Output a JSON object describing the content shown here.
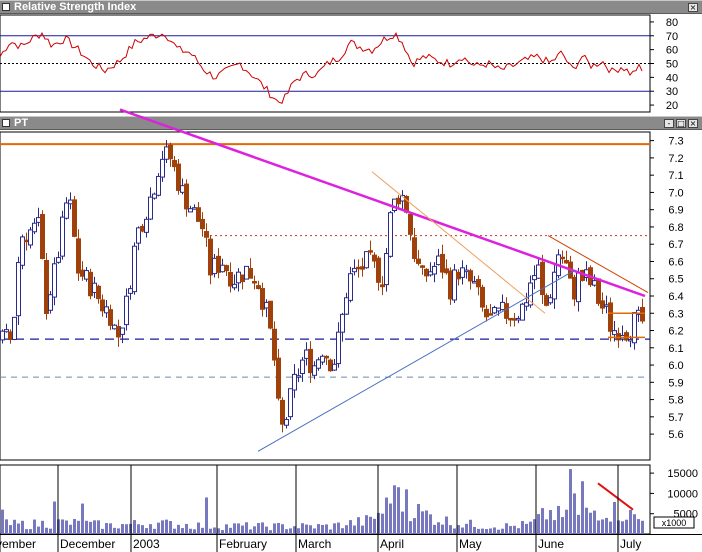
{
  "rsi_panel": {
    "title": "Relative Strength Index",
    "y_ticks": [
      80,
      70,
      60,
      50,
      40,
      30,
      20
    ],
    "levels": {
      "upper": 70,
      "mid": 50,
      "lower": 30
    },
    "ylim": [
      15,
      85
    ],
    "line_color": "#cc0000"
  },
  "price_panel": {
    "title": "PT",
    "y_ticks": [
      7.3,
      7.2,
      7.1,
      7.0,
      6.9,
      6.8,
      6.7,
      6.6,
      6.5,
      6.4,
      6.3,
      6.2,
      6.1,
      6.0,
      5.9,
      5.8,
      5.7,
      5.6
    ],
    "ylim": [
      5.45,
      7.35
    ]
  },
  "volume_panel": {
    "y_ticks": [
      "15000",
      "10000",
      "5000"
    ],
    "unit_label": "x1000",
    "ylim": [
      0,
      17000
    ],
    "bar_color": "#7878c0"
  },
  "window_buttons": {
    "minimize": "-",
    "maximize": "□",
    "close": "×"
  },
  "colors": {
    "up_candle_fill": "#ffffff",
    "up_candle_border": "#2a2a8a",
    "down_candle": "#a0400a",
    "resistance_line": "#e0e000",
    "orange_line": "#e26a00",
    "magenta_trend": "#dd22dd",
    "blue_dash": "#1a1a9a",
    "red_dotted": "#cc3333"
  },
  "chart_data": {
    "type": "candlestick",
    "x_axis_labels": [
      "vember",
      "December",
      "2003",
      "February",
      "March",
      "April",
      "May",
      "June",
      "July"
    ],
    "price": {
      "anchors": [
        [
          0,
          6.15
        ],
        [
          12,
          6.15
        ],
        [
          20,
          6.75
        ],
        [
          38,
          6.8
        ],
        [
          46,
          6.35
        ],
        [
          55,
          6.55
        ],
        [
          68,
          7.0
        ],
        [
          78,
          6.55
        ],
        [
          92,
          6.45
        ],
        [
          102,
          6.35
        ],
        [
          110,
          6.3
        ],
        [
          117,
          6.15
        ],
        [
          126,
          6.35
        ],
        [
          136,
          6.75
        ],
        [
          152,
          7.0
        ],
        [
          161,
          7.22
        ],
        [
          170,
          7.2
        ],
        [
          182,
          7.0
        ],
        [
          192,
          6.9
        ],
        [
          202,
          6.8
        ],
        [
          210,
          6.55
        ],
        [
          222,
          6.6
        ],
        [
          233,
          6.5
        ],
        [
          246,
          6.55
        ],
        [
          257,
          6.5
        ],
        [
          266,
          6.3
        ],
        [
          273,
          6.1
        ],
        [
          280,
          5.6
        ],
        [
          286,
          5.7
        ],
        [
          294,
          5.9
        ],
        [
          304,
          6.05
        ],
        [
          314,
          6.0
        ],
        [
          322,
          6.1
        ],
        [
          333,
          6.0
        ],
        [
          340,
          6.2
        ],
        [
          348,
          6.5
        ],
        [
          358,
          6.55
        ],
        [
          368,
          6.6
        ],
        [
          376,
          6.55
        ],
        [
          383,
          6.5
        ],
        [
          391,
          6.9
        ],
        [
          399,
          7.0
        ],
        [
          405,
          6.95
        ],
        [
          412,
          6.7
        ],
        [
          421,
          6.5
        ],
        [
          430,
          6.55
        ],
        [
          440,
          6.6
        ],
        [
          450,
          6.45
        ],
        [
          458,
          6.55
        ],
        [
          466,
          6.5
        ],
        [
          475,
          6.45
        ],
        [
          483,
          6.3
        ],
        [
          491,
          6.25
        ],
        [
          500,
          6.3
        ],
        [
          508,
          6.3
        ],
        [
          517,
          6.3
        ],
        [
          524,
          6.35
        ],
        [
          531,
          6.5
        ],
        [
          538,
          6.55
        ],
        [
          544,
          6.3
        ],
        [
          551,
          6.45
        ],
        [
          558,
          6.65
        ],
        [
          565,
          6.6
        ],
        [
          572,
          6.4
        ],
        [
          578,
          6.5
        ],
        [
          586,
          6.5
        ],
        [
          593,
          6.45
        ],
        [
          600,
          6.35
        ],
        [
          606,
          6.3
        ],
        [
          612,
          6.2
        ],
        [
          620,
          6.22
        ],
        [
          628,
          6.2
        ],
        [
          634,
          6.25
        ],
        [
          640,
          6.25
        ]
      ],
      "key_levels": {
        "orange_resistance": 7.28,
        "red_dotted_resistance": 6.75,
        "blue_dashed_support": 6.15,
        "grey_dashed_support": 5.93
      },
      "trendlines": [
        {
          "name": "magenta down-trend",
          "from": [
            120,
            7.48
          ],
          "to": [
            645,
            6.4
          ]
        },
        {
          "name": "blue up-trend",
          "from": [
            258,
            5.5
          ],
          "to": [
            575,
            6.55
          ]
        },
        {
          "name": "orange down-trend (Apr-May)",
          "from": [
            372,
            7.12
          ],
          "to": [
            545,
            6.3
          ]
        },
        {
          "name": "orange down-trend (Jun-Jul)",
          "from": [
            548,
            6.75
          ],
          "to": [
            648,
            6.42
          ]
        }
      ],
      "triangle_box": {
        "x": [
          608,
          645
        ],
        "top": 6.3,
        "bottom": 6.16
      }
    },
    "rsi": {
      "anchors": [
        [
          0,
          55
        ],
        [
          10,
          66
        ],
        [
          22,
          62
        ],
        [
          32,
          68
        ],
        [
          42,
          72
        ],
        [
          52,
          63
        ],
        [
          65,
          68
        ],
        [
          78,
          60
        ],
        [
          92,
          50
        ],
        [
          105,
          45
        ],
        [
          120,
          52
        ],
        [
          135,
          65
        ],
        [
          152,
          70
        ],
        [
          165,
          72
        ],
        [
          178,
          60
        ],
        [
          190,
          58
        ],
        [
          205,
          45
        ],
        [
          215,
          40
        ],
        [
          228,
          45
        ],
        [
          240,
          50
        ],
        [
          255,
          40
        ],
        [
          268,
          30
        ],
        [
          278,
          22
        ],
        [
          285,
          25
        ],
        [
          295,
          38
        ],
        [
          305,
          42
        ],
        [
          318,
          43
        ],
        [
          328,
          50
        ],
        [
          340,
          55
        ],
        [
          350,
          65
        ],
        [
          360,
          62
        ],
        [
          372,
          60
        ],
        [
          385,
          68
        ],
        [
          395,
          72
        ],
        [
          403,
          65
        ],
        [
          412,
          50
        ],
        [
          425,
          55
        ],
        [
          438,
          52
        ],
        [
          450,
          50
        ],
        [
          462,
          55
        ],
        [
          475,
          48
        ],
        [
          488,
          50
        ],
        [
          500,
          45
        ],
        [
          512,
          48
        ],
        [
          525,
          52
        ],
        [
          538,
          55
        ],
        [
          550,
          50
        ],
        [
          562,
          58
        ],
        [
          572,
          45
        ],
        [
          582,
          55
        ],
        [
          592,
          48
        ],
        [
          602,
          52
        ],
        [
          612,
          44
        ],
        [
          622,
          48
        ],
        [
          632,
          42
        ],
        [
          638,
          48
        ],
        [
          642,
          44
        ]
      ]
    },
    "volume": {
      "anchors": [
        [
          0,
          2500
        ],
        [
          30,
          2500
        ],
        [
          60,
          3000
        ],
        [
          110,
          2200
        ],
        [
          150,
          2800
        ],
        [
          200,
          2200
        ],
        [
          260,
          2000
        ],
        [
          290,
          2000
        ],
        [
          330,
          2000
        ],
        [
          370,
          3500
        ],
        [
          395,
          9000
        ],
        [
          420,
          5500
        ],
        [
          450,
          3000
        ],
        [
          480,
          2200
        ],
        [
          510,
          2000
        ],
        [
          530,
          2500
        ],
        [
          548,
          5500
        ],
        [
          570,
          4000
        ],
        [
          600,
          6500
        ],
        [
          625,
          5500
        ],
        [
          645,
          3000
        ]
      ],
      "spikes": [
        [
          2,
          6000
        ],
        [
          55,
          8000
        ],
        [
          82,
          7500
        ],
        [
          132,
          8000
        ],
        [
          206,
          9000
        ],
        [
          394,
          12000
        ],
        [
          400,
          14000
        ],
        [
          405,
          11000
        ],
        [
          408,
          9500
        ],
        [
          548,
          8000
        ],
        [
          552,
          9000
        ],
        [
          570,
          16000
        ],
        [
          575,
          10000
        ],
        [
          583,
          13000
        ]
      ],
      "trend_line": {
        "from": [
          598,
          12500
        ],
        "to": [
          633,
          6000
        ]
      }
    }
  }
}
